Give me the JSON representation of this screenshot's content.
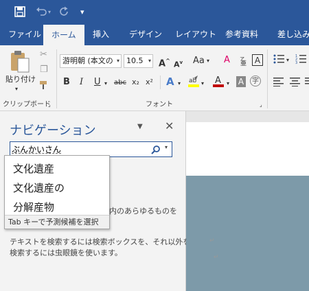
{
  "quick_access": {
    "save_icon": "save-icon",
    "undo_icon": "undo-icon",
    "redo_icon": "redo-icon",
    "customize_icon": "customize-qat-icon"
  },
  "tabs": [
    {
      "label": "ファイル"
    },
    {
      "label": "ホーム"
    },
    {
      "label": "挿入"
    },
    {
      "label": "デザイン"
    },
    {
      "label": "レイアウト"
    },
    {
      "label": "参考資料"
    },
    {
      "label": "差し込み"
    }
  ],
  "ribbon": {
    "clipboard": {
      "paste_label": "貼り付け",
      "group_label": "クリップボード"
    },
    "font": {
      "font_name": "游明朝 (本文の",
      "font_size": "10.5",
      "group_label": "フォント",
      "case_label": "Aa",
      "bold": "B",
      "italic": "I",
      "underline": "U",
      "strike": "abc",
      "subscript": "x₂",
      "superscript": "x²"
    }
  },
  "nav_pane": {
    "title": "ナビゲーション",
    "search_value": "ぶんかいさん",
    "suggestions": [
      "文化遺産",
      "文化遺産の",
      "分解産物"
    ],
    "hint": "Tab キーで予測候補を選択",
    "partial_text": "内のあらゆるものを",
    "help_line1": "テキストを検索するには検索ボックスを、それ以外を",
    "help_line2": "検索するには虫眼鏡を使います。"
  },
  "colors": {
    "accent": "#2b579a",
    "ribbon_bg": "#f3f3f3",
    "doc_blue": "#7d9aa9",
    "font_color_red": "#c00000",
    "highlight_yellow": "#ffff00"
  }
}
